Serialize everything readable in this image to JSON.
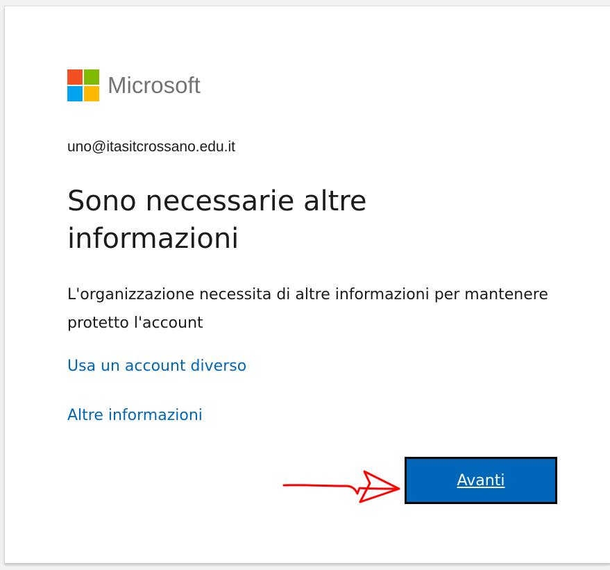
{
  "brand": {
    "name": "Microsoft",
    "logo_colors": [
      "#f25022",
      "#7fba00",
      "#00a4ef",
      "#ffb900"
    ],
    "text_color": "#737373"
  },
  "account": {
    "email": "uno@itasitcrossano.edu.it"
  },
  "main": {
    "title": "Sono necessarie altre informazioni",
    "description": "L'organizzazione necessita di altre informazioni per mantenere protetto l'account"
  },
  "links": {
    "use_different_account": "Usa un account diverso",
    "more_info": "Altre informazioni",
    "color": "#0067b8"
  },
  "actions": {
    "next_label": "Avanti",
    "next_bg": "#0067b8"
  },
  "annotation": {
    "arrow_color": "#ff0000",
    "arrow_icon": "hand-drawn-arrow-icon"
  }
}
